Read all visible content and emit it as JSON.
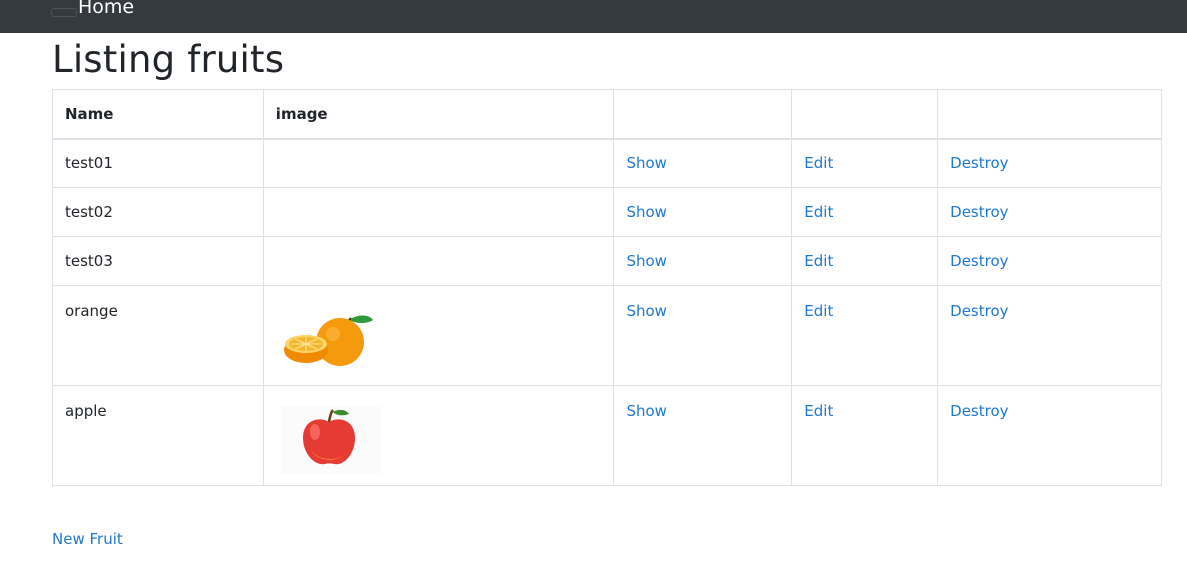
{
  "navbar": {
    "brand": "Home",
    "bg_color": "#343a40"
  },
  "page": {
    "title": "Listing fruits",
    "new_link": "New Fruit",
    "link_color": "#1f78d1"
  },
  "table": {
    "headers": [
      "Name",
      "image",
      "",
      "",
      ""
    ],
    "rows": [
      {
        "name": "test01",
        "image": "",
        "show": "Show",
        "edit": "Edit",
        "destroy": "Destroy"
      },
      {
        "name": "test02",
        "image": "",
        "show": "Show",
        "edit": "Edit",
        "destroy": "Destroy"
      },
      {
        "name": "test03",
        "image": "",
        "show": "Show",
        "edit": "Edit",
        "destroy": "Destroy"
      },
      {
        "name": "orange",
        "image": "orange-image",
        "show": "Show",
        "edit": "Edit",
        "destroy": "Destroy"
      },
      {
        "name": "apple",
        "image": "apple-image",
        "show": "Show",
        "edit": "Edit",
        "destroy": "Destroy"
      }
    ]
  }
}
